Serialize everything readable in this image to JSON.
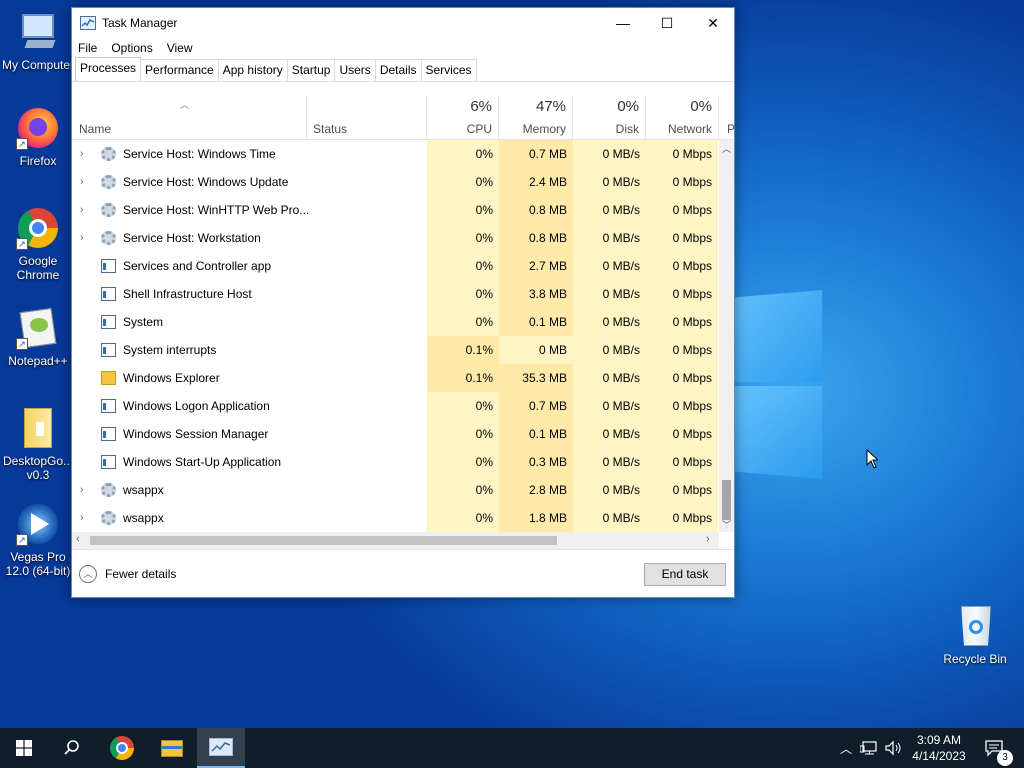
{
  "desktop": {
    "icons": [
      {
        "label": "My Computer",
        "name": "my-computer"
      },
      {
        "label": "Firefox",
        "name": "firefox"
      },
      {
        "label": "Google Chrome",
        "name": "google-chrome"
      },
      {
        "label": "Notepad++",
        "name": "notepad-plus-plus"
      },
      {
        "label": "DesktopGo... v0.3",
        "name": "desktopgo"
      },
      {
        "label": "Vegas Pro 12.0 (64-bit)",
        "name": "vegas-pro"
      },
      {
        "label": "Recycle Bin",
        "name": "recycle-bin"
      }
    ]
  },
  "window": {
    "title": "Task Manager",
    "controls": {
      "minimize": "—",
      "maximize": "☐",
      "close": "✕"
    },
    "menu": [
      "File",
      "Options",
      "View"
    ],
    "tabs": [
      "Processes",
      "Performance",
      "App history",
      "Startup",
      "Users",
      "Details",
      "Services"
    ],
    "active_tab": "Processes",
    "columns": {
      "name": "Name",
      "status": "Status",
      "cpu": {
        "label": "CPU",
        "pct": "6%"
      },
      "memory": {
        "label": "Memory",
        "pct": "47%"
      },
      "disk": {
        "label": "Disk",
        "pct": "0%"
      },
      "network": {
        "label": "Network",
        "pct": "0%"
      },
      "extra": "P"
    },
    "processes": [
      {
        "name": "Service Host: Windows Time",
        "icon": "gear",
        "expandable": true,
        "cpu": "0%",
        "memory": "0.7 MB",
        "disk": "0 MB/s",
        "network": "0 Mbps"
      },
      {
        "name": "Service Host: Windows Update",
        "icon": "gear",
        "expandable": true,
        "cpu": "0%",
        "memory": "2.4 MB",
        "disk": "0 MB/s",
        "network": "0 Mbps"
      },
      {
        "name": "Service Host: WinHTTP Web Pro...",
        "icon": "gear",
        "expandable": true,
        "cpu": "0%",
        "memory": "0.8 MB",
        "disk": "0 MB/s",
        "network": "0 Mbps"
      },
      {
        "name": "Service Host: Workstation",
        "icon": "gear",
        "expandable": true,
        "cpu": "0%",
        "memory": "0.8 MB",
        "disk": "0 MB/s",
        "network": "0 Mbps"
      },
      {
        "name": "Services and Controller app",
        "icon": "app",
        "expandable": false,
        "cpu": "0%",
        "memory": "2.7 MB",
        "disk": "0 MB/s",
        "network": "0 Mbps"
      },
      {
        "name": "Shell Infrastructure Host",
        "icon": "app",
        "expandable": false,
        "cpu": "0%",
        "memory": "3.8 MB",
        "disk": "0 MB/s",
        "network": "0 Mbps"
      },
      {
        "name": "System",
        "icon": "app",
        "expandable": false,
        "cpu": "0%",
        "memory": "0.1 MB",
        "disk": "0 MB/s",
        "network": "0 Mbps"
      },
      {
        "name": "System interrupts",
        "icon": "app",
        "expandable": false,
        "cpu": "0.1%",
        "memory": "0 MB",
        "disk": "0 MB/s",
        "network": "0 Mbps"
      },
      {
        "name": "Windows Explorer",
        "icon": "folder",
        "expandable": false,
        "cpu": "0.1%",
        "memory": "35.3 MB",
        "disk": "0 MB/s",
        "network": "0 Mbps"
      },
      {
        "name": "Windows Logon Application",
        "icon": "app",
        "expandable": false,
        "cpu": "0%",
        "memory": "0.7 MB",
        "disk": "0 MB/s",
        "network": "0 Mbps"
      },
      {
        "name": "Windows Session Manager",
        "icon": "app",
        "expandable": false,
        "cpu": "0%",
        "memory": "0.1 MB",
        "disk": "0 MB/s",
        "network": "0 Mbps"
      },
      {
        "name": "Windows Start-Up Application",
        "icon": "app",
        "expandable": false,
        "cpu": "0%",
        "memory": "0.3 MB",
        "disk": "0 MB/s",
        "network": "0 Mbps"
      },
      {
        "name": "wsappx",
        "icon": "gear",
        "expandable": true,
        "cpu": "0%",
        "memory": "2.8 MB",
        "disk": "0 MB/s",
        "network": "0 Mbps"
      },
      {
        "name": "wsappx",
        "icon": "gear",
        "expandable": true,
        "cpu": "0%",
        "memory": "1.8 MB",
        "disk": "0 MB/s",
        "network": "0 Mbps"
      }
    ],
    "footer": {
      "fewer_details": "Fewer details",
      "end_task": "End task"
    }
  },
  "taskbar": {
    "clock_time": "3:09 AM",
    "clock_date": "4/14/2023",
    "notification_count": "3"
  },
  "colors": {
    "heat_light": "#fff4c4",
    "heat_medium": "#ffe9a8",
    "accent": "#0078d7"
  }
}
